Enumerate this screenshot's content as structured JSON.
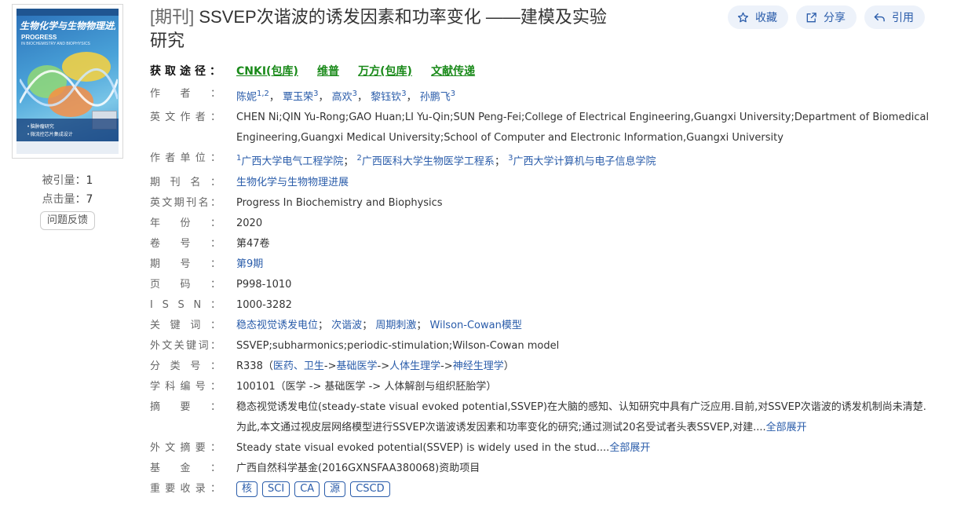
{
  "cover": {
    "title_cn": "生物化学与生物物理进展",
    "title_en1": "PROGRESS",
    "title_en2": "IN BIOCHEMISTRY AND BIOPHYSICS",
    "band_text1": "• 脑肿瘤研究",
    "band_text2": "• 微流控芯片集成设计"
  },
  "stats": {
    "cited_label": "被引量：",
    "cited_value": "1",
    "clicks_label": "点击量：",
    "clicks_value": "7",
    "feedback_label": "问题反馈"
  },
  "title": {
    "tag": "[期刊]",
    "text": " SSVEP次谐波的诱发因素和功率变化 ——建模及实验研究"
  },
  "actions": {
    "collect": "收藏",
    "share": "分享",
    "cite": "引用"
  },
  "access": {
    "label": "获取途径：",
    "links": [
      "CNKI(包库)",
      "维普",
      "万方(包库)",
      "文献传递"
    ]
  },
  "authors": {
    "label": "作者：",
    "items": [
      {
        "name": "陈妮",
        "sup": "1,2"
      },
      {
        "name": "覃玉荣",
        "sup": "3"
      },
      {
        "name": "高欢",
        "sup": "3"
      },
      {
        "name": "黎钰钦",
        "sup": "3"
      },
      {
        "name": "孙鹏飞",
        "sup": "3"
      }
    ]
  },
  "en_authors": {
    "label": "英文作者：",
    "value": "CHEN Ni;QIN Yu-Rong;GAO Huan;LI Yu-Qin;SUN Peng-Fei;College of Electrical Engineering,Guangxi University;Department of Biomedical Engineering,Guangxi Medical University;School of Computer and Electronic Information,Guangxi University"
  },
  "affiliations": {
    "label": "作者单位：",
    "items": [
      {
        "sup": "1",
        "name": "广西大学电气工程学院"
      },
      {
        "sup": "2",
        "name": "广西医科大学生物医学工程系"
      },
      {
        "sup": "3",
        "name": "广西大学计算机与电子信息学院"
      }
    ]
  },
  "journal": {
    "label": "期刊名：",
    "value": "生物化学与生物物理进展"
  },
  "journal_en": {
    "label": "英文期刊名：",
    "value": "Progress In Biochemistry and Biophysics"
  },
  "year": {
    "label": "年份：",
    "value": "2020"
  },
  "volume": {
    "label": "卷号：",
    "value": "第47卷"
  },
  "issue": {
    "label": "期号：",
    "value": "第9期"
  },
  "pages": {
    "label": "页码：",
    "value": "P998-1010"
  },
  "issn": {
    "label": "ISSN：",
    "value": "1000-3282"
  },
  "keywords": {
    "label": "关键词：",
    "items": [
      "稳态视觉诱发电位",
      "次谐波",
      "周期刺激",
      "Wilson-Cowan模型"
    ]
  },
  "keywords_en": {
    "label": "外文关键词：",
    "value": "SSVEP;subharmonics;periodic-stimulation;Wilson-Cowan model"
  },
  "classification": {
    "label": "分类号：",
    "code": "R338",
    "open": "（",
    "path": [
      "医药、卫生",
      "基础医学",
      "人体生理学",
      "神经生理学"
    ],
    "sep": "->",
    "close": "）"
  },
  "subject": {
    "label": "学科编号：",
    "value": "100101（医学 -> 基础医学 -> 人体解剖与组织胚胎学）"
  },
  "abstract": {
    "label": "摘要：",
    "value": "稳态视觉诱发电位(steady-state visual evoked potential,SSVEP)在大脑的感知、认知研究中具有广泛应用.目前,对SSVEP次谐波的诱发机制尚未清楚.为此,本文通过视皮层网络模型进行SSVEP次谐波诱发因素和功率变化的研究;通过测试20名受试者头表SSVEP,对建....",
    "expand": "全部展开"
  },
  "abstract_en": {
    "label": "外文摘要：",
    "value": "Steady state visual evoked potential(SSVEP) is widely used in the stud....",
    "expand": "全部展开"
  },
  "fund": {
    "label": "基金：",
    "value": "广西自然科学基金(2016GXNSFAA380068)资助项目"
  },
  "indexing": {
    "label": "重要收录：",
    "items": [
      "核",
      "SCI",
      "CA",
      "源",
      "CSCD"
    ]
  }
}
